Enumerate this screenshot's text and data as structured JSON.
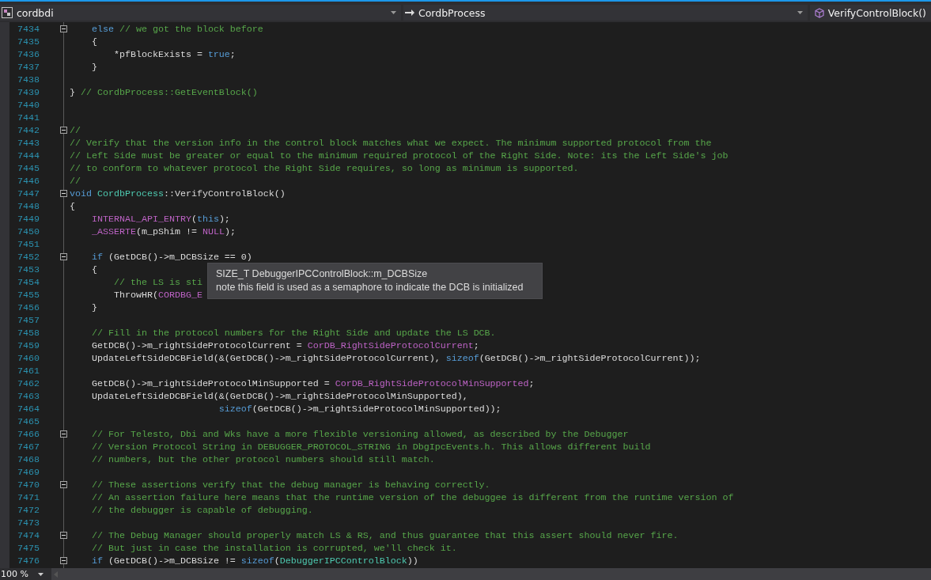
{
  "navigation_bar": {
    "project": "cordbdi",
    "scope": "CordbProcess",
    "member": "VerifyControlBlock()"
  },
  "editor": {
    "lines": [
      {
        "number": "7434",
        "fold": true,
        "tokens": [
          {
            "kind": "keyword",
            "text": "    else"
          },
          {
            "kind": "comment",
            "text": " // we got the block before"
          }
        ]
      },
      {
        "number": "7435",
        "fold": false,
        "tokens": [
          {
            "kind": "plain",
            "text": "    {"
          }
        ]
      },
      {
        "number": "7436",
        "fold": false,
        "tokens": [
          {
            "kind": "plain",
            "text": "        *pfBlockExists = "
          },
          {
            "kind": "keyword",
            "text": "true"
          },
          {
            "kind": "plain",
            "text": ";"
          }
        ]
      },
      {
        "number": "7437",
        "fold": false,
        "tokens": [
          {
            "kind": "plain",
            "text": "    }"
          }
        ]
      },
      {
        "number": "7438",
        "fold": false
      },
      {
        "number": "7439",
        "fold": false,
        "tokens": [
          {
            "kind": "plain",
            "text": "}"
          },
          {
            "kind": "comment",
            "text": " // CordbProcess::GetEventBlock()"
          }
        ]
      },
      {
        "number": "7440",
        "fold": false
      },
      {
        "number": "7441",
        "fold": false
      },
      {
        "number": "7442",
        "fold": true,
        "tokens": [
          {
            "kind": "comment",
            "text": "//"
          }
        ]
      },
      {
        "number": "7443",
        "fold": false,
        "tokens": [
          {
            "kind": "comment",
            "text": "// Verify that the version info in the control block matches what we expect. The minimum supported protocol from the"
          }
        ]
      },
      {
        "number": "7444",
        "fold": false,
        "tokens": [
          {
            "kind": "comment",
            "text": "// Left Side must be greater or equal to the minimum required protocol of the Right Side. Note: its the Left Side's job"
          }
        ]
      },
      {
        "number": "7445",
        "fold": false,
        "tokens": [
          {
            "kind": "comment",
            "text": "// to conform to whatever protocol the Right Side requires, so long as minimum is supported."
          }
        ]
      },
      {
        "number": "7446",
        "fold": false,
        "tokens": [
          {
            "kind": "comment",
            "text": "//"
          }
        ]
      },
      {
        "number": "7447",
        "fold": true,
        "tokens": [
          {
            "kind": "keyword",
            "text": "void "
          },
          {
            "kind": "type",
            "text": "CordbProcess"
          },
          {
            "kind": "plain",
            "text": "::VerifyControlBlock()"
          }
        ]
      },
      {
        "number": "7448",
        "fold": false,
        "tokens": [
          {
            "kind": "plain",
            "text": "{"
          }
        ]
      },
      {
        "number": "7449",
        "fold": false,
        "tokens": [
          {
            "kind": "macro",
            "text": "    INTERNAL_API_ENTRY"
          },
          {
            "kind": "plain",
            "text": "("
          },
          {
            "kind": "keyword",
            "text": "this"
          },
          {
            "kind": "plain",
            "text": ");"
          }
        ]
      },
      {
        "number": "7450",
        "fold": false,
        "tokens": [
          {
            "kind": "macro",
            "text": "    _ASSERTE"
          },
          {
            "kind": "plain",
            "text": "(m_pShim != "
          },
          {
            "kind": "macro",
            "text": "NULL"
          },
          {
            "kind": "plain",
            "text": ");"
          }
        ]
      },
      {
        "number": "7451",
        "fold": false
      },
      {
        "number": "7452",
        "fold": true,
        "tokens": [
          {
            "kind": "keyword",
            "text": "    if"
          },
          {
            "kind": "plain",
            "text": " (GetDCB()->m_DCBSize == 0)"
          }
        ]
      },
      {
        "number": "7453",
        "fold": false,
        "tokens": [
          {
            "kind": "plain",
            "text": "    {"
          }
        ]
      },
      {
        "number": "7454",
        "fold": false,
        "tokens": [
          {
            "kind": "comment",
            "text": "        // the LS is sti"
          }
        ]
      },
      {
        "number": "7455",
        "fold": false,
        "tokens": [
          {
            "kind": "plain",
            "text": "        ThrowHR("
          },
          {
            "kind": "macro",
            "text": "CORDBG_E"
          }
        ]
      },
      {
        "number": "7456",
        "fold": false,
        "tokens": [
          {
            "kind": "plain",
            "text": "    }"
          }
        ]
      },
      {
        "number": "7457",
        "fold": false
      },
      {
        "number": "7458",
        "fold": false,
        "tokens": [
          {
            "kind": "comment",
            "text": "    // Fill in the protocol numbers for the Right Side and update the LS DCB."
          }
        ]
      },
      {
        "number": "7459",
        "fold": false,
        "tokens": [
          {
            "kind": "plain",
            "text": "    GetDCB()->m_rightSideProtocolCurrent = "
          },
          {
            "kind": "macro",
            "text": "CorDB_RightSideProtocolCurrent"
          },
          {
            "kind": "plain",
            "text": ";"
          }
        ]
      },
      {
        "number": "7460",
        "fold": false,
        "tokens": [
          {
            "kind": "plain",
            "text": "    UpdateLeftSideDCBField(&(GetDCB()->m_rightSideProtocolCurrent), "
          },
          {
            "kind": "keyword",
            "text": "sizeof"
          },
          {
            "kind": "plain",
            "text": "(GetDCB()->m_rightSideProtocolCurrent));"
          }
        ]
      },
      {
        "number": "7461",
        "fold": false
      },
      {
        "number": "7462",
        "fold": false,
        "tokens": [
          {
            "kind": "plain",
            "text": "    GetDCB()->m_rightSideProtocolMinSupported = "
          },
          {
            "kind": "macro",
            "text": "CorDB_RightSideProtocolMinSupported"
          },
          {
            "kind": "plain",
            "text": ";"
          }
        ]
      },
      {
        "number": "7463",
        "fold": false,
        "tokens": [
          {
            "kind": "plain",
            "text": "    UpdateLeftSideDCBField(&(GetDCB()->m_rightSideProtocolMinSupported),"
          }
        ]
      },
      {
        "number": "7464",
        "fold": false,
        "tokens": [
          {
            "kind": "keyword",
            "text": "                           sizeof"
          },
          {
            "kind": "plain",
            "text": "(GetDCB()->m_rightSideProtocolMinSupported));"
          }
        ]
      },
      {
        "number": "7465",
        "fold": false
      },
      {
        "number": "7466",
        "fold": true,
        "tokens": [
          {
            "kind": "comment",
            "text": "    // For Telesto, Dbi and Wks have a more flexible versioning allowed, as described by the Debugger"
          }
        ]
      },
      {
        "number": "7467",
        "fold": false,
        "tokens": [
          {
            "kind": "comment",
            "text": "    // Version Protocol String in DEBUGGER_PROTOCOL_STRING in DbgIpcEvents.h. This allows different build"
          }
        ]
      },
      {
        "number": "7468",
        "fold": false,
        "tokens": [
          {
            "kind": "comment",
            "text": "    // numbers, but the other protocol numbers should still match."
          }
        ]
      },
      {
        "number": "7469",
        "fold": false
      },
      {
        "number": "7470",
        "fold": true,
        "tokens": [
          {
            "kind": "comment",
            "text": "    // These assertions verify that the debug manager is behaving correctly."
          }
        ]
      },
      {
        "number": "7471",
        "fold": false,
        "tokens": [
          {
            "kind": "comment",
            "text": "    // An assertion failure here means that the runtime version of the debuggee is different from the runtime version of"
          }
        ]
      },
      {
        "number": "7472",
        "fold": false,
        "tokens": [
          {
            "kind": "comment",
            "text": "    // the debugger is capable of debugging."
          }
        ]
      },
      {
        "number": "7473",
        "fold": false
      },
      {
        "number": "7474",
        "fold": true,
        "tokens": [
          {
            "kind": "comment",
            "text": "    // The Debug Manager should properly match LS & RS, and thus guarantee that this assert should never fire."
          }
        ]
      },
      {
        "number": "7475",
        "fold": false,
        "tokens": [
          {
            "kind": "comment",
            "text": "    // But just in case the installation is corrupted, we'll check it."
          }
        ]
      },
      {
        "number": "7476",
        "fold": true,
        "tokens": [
          {
            "kind": "keyword",
            "text": "    if"
          },
          {
            "kind": "plain",
            "text": " (GetDCB()->m_DCBSize != "
          },
          {
            "kind": "keyword",
            "text": "sizeof"
          },
          {
            "kind": "plain",
            "text": "("
          },
          {
            "kind": "type",
            "text": "DebuggerIPCControlBlock"
          },
          {
            "kind": "plain",
            "text": "))"
          }
        ]
      }
    ]
  },
  "tooltip": {
    "signature": "SIZE_T DebuggerIPCControlBlock::m_DCBSize",
    "description": "note this field is used as a semaphore to indicate the DCB is initialized"
  },
  "status_bar": {
    "zoom": "100 %"
  }
}
